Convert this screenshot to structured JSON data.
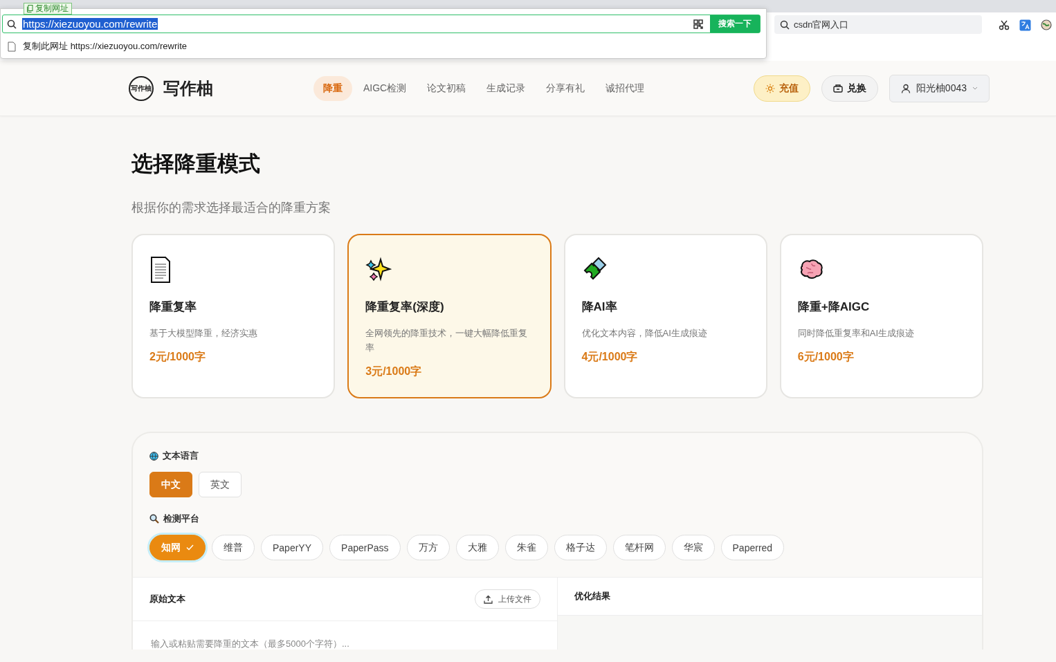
{
  "browser": {
    "tooltip": "复制网址",
    "address_bar": {
      "value": "https://xiezuoyou.com/rewrite",
      "search_button": "搜索一下"
    },
    "suggestions": [
      {
        "label": "复制此网址",
        "url": "https://xiezuoyou.com/rewrite"
      }
    ],
    "search_field": {
      "value": "csdn官网入口"
    }
  },
  "header": {
    "logo_badge": "写作柚",
    "logo": "写作柚",
    "nav": [
      {
        "label": "降重",
        "selected": true
      },
      {
        "label": "AIGC检测",
        "selected": false
      },
      {
        "label": "论文初稿",
        "selected": false
      },
      {
        "label": "生成记录",
        "selected": false
      },
      {
        "label": "分享有礼",
        "selected": false
      },
      {
        "label": "诚招代理",
        "selected": false
      }
    ],
    "recharge_button": "充值",
    "redeem_button": "兑换",
    "user": "阳光柚0043"
  },
  "title": "选择降重模式",
  "subtitle": "根据你的需求选择最适合的降重方案",
  "modes": [
    {
      "kind": "document",
      "title": "降重复率",
      "description": "基于大模型降重，经济实惠",
      "price": "2元/1000字",
      "selected": false
    },
    {
      "kind": "sparkles",
      "title": "降重复率(深度)",
      "description": "全网领先的降重技术，一键大幅降低重复率",
      "price": "3元/1000字",
      "selected": true
    },
    {
      "kind": "puzzle",
      "title": "降AI率",
      "description": "优化文本内容，降低AI生成痕迹",
      "price": "4元/1000字",
      "selected": false
    },
    {
      "kind": "brain",
      "title": "降重+降AIGC",
      "description": "同时降低重复率和AI生成痕迹",
      "price": "6元/1000字",
      "selected": false
    }
  ],
  "language": {
    "label": "文本语言",
    "options": [
      {
        "label": "中文",
        "selected": true
      },
      {
        "label": "英文",
        "selected": false
      }
    ]
  },
  "platform": {
    "label": "检测平台",
    "options": [
      {
        "label": "知网",
        "selected": true
      },
      {
        "label": "维普",
        "selected": false
      },
      {
        "label": "PaperYY",
        "selected": false
      },
      {
        "label": "PaperPass",
        "selected": false
      },
      {
        "label": "万方",
        "selected": false
      },
      {
        "label": "大雅",
        "selected": false
      },
      {
        "label": "朱雀",
        "selected": false
      },
      {
        "label": "格子达",
        "selected": false
      },
      {
        "label": "笔杆网",
        "selected": false
      },
      {
        "label": "华宸",
        "selected": false
      },
      {
        "label": "Paperred",
        "selected": false
      }
    ]
  },
  "editor": {
    "source_title": "原始文本",
    "upload_button": "上传文件",
    "placeholder": "输入或粘贴需要降重的文本（最多5000个字符）...",
    "result_title": "优化结果"
  }
}
